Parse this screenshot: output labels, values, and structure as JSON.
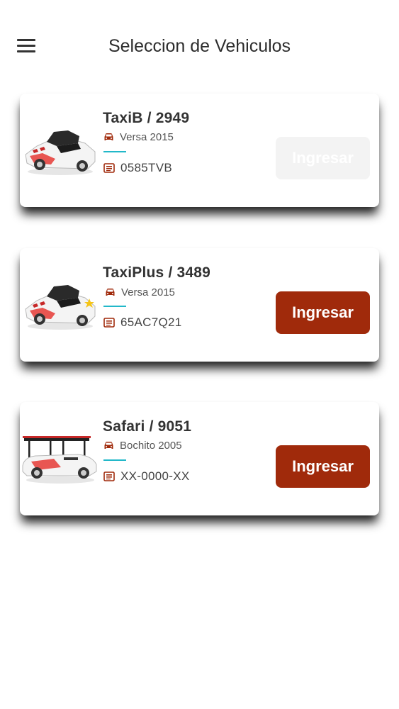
{
  "header": {
    "title": "Seleccion de Vehiculos",
    "menu_icon": "hamburger-menu-icon"
  },
  "colors": {
    "accent": "#a02a0b",
    "divider": "#22b8c9",
    "disabled_button": "#f3f3f3"
  },
  "vehicles": [
    {
      "title": "TaxiB / 2949",
      "model": "Versa 2015",
      "plate": "0585TVB",
      "button_label": "Ingresar",
      "button_enabled": false,
      "image": "sedan-taxi-image"
    },
    {
      "title": "TaxiPlus / 3489",
      "model": "Versa 2015",
      "plate": "65AC7Q21",
      "button_label": "Ingresar",
      "button_enabled": true,
      "image": "sedan-taxi-star-image"
    },
    {
      "title": "Safari / 9051",
      "model": "Bochito 2005",
      "plate": "XX-0000-XX",
      "button_label": "Ingresar",
      "button_enabled": true,
      "image": "safari-taxi-image"
    }
  ]
}
